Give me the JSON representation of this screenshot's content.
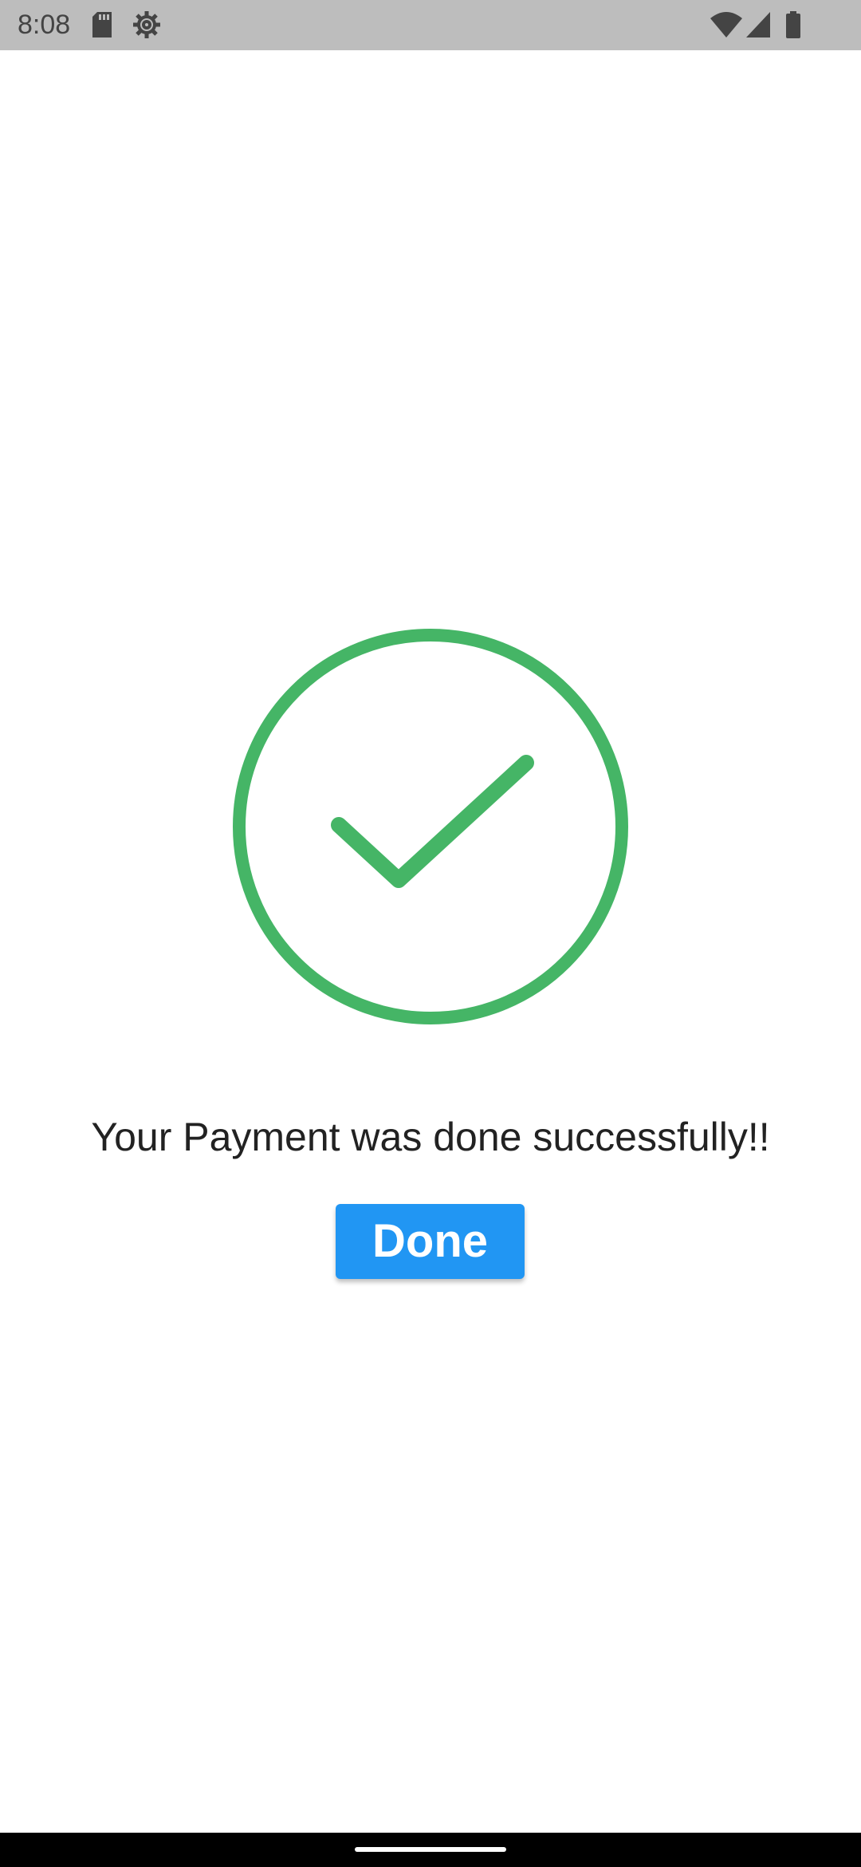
{
  "status_bar": {
    "time": "8:08",
    "icons": [
      "sd-card-icon",
      "settings-gear-icon",
      "wifi-icon",
      "cell-signal-icon",
      "battery-icon"
    ]
  },
  "success": {
    "icon": "check-circle-icon",
    "color": "#45b566",
    "message": "Your Payment was done successfully!!"
  },
  "actions": {
    "done_label": "Done",
    "button_color": "#2196f3"
  },
  "navigation": {
    "home_indicator": "gesture-home-bar"
  }
}
